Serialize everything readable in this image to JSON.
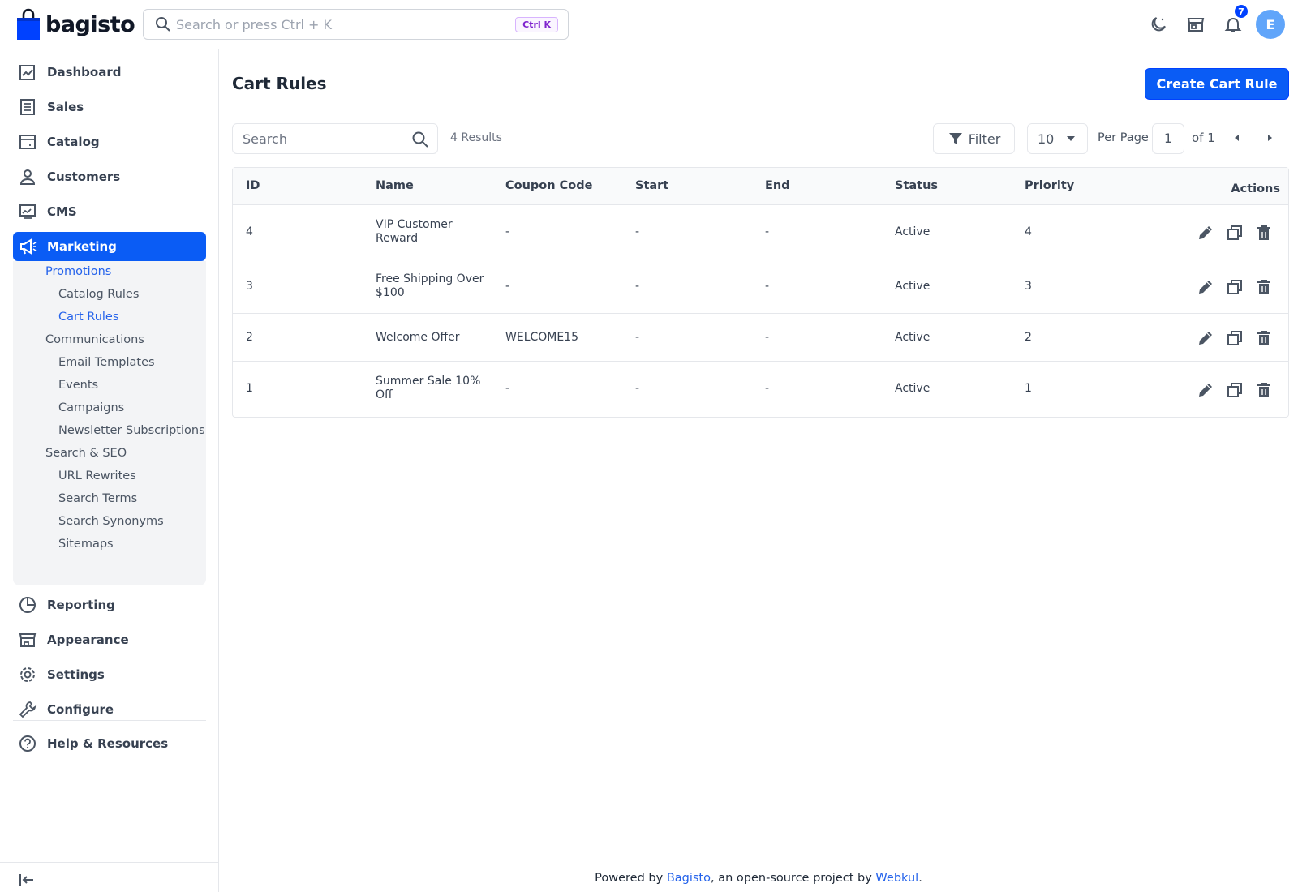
{
  "app": {
    "logo_text": "bagisto"
  },
  "header": {
    "search_placeholder": "Search or press Ctrl + K",
    "shortcut": "Ctrl K",
    "notification_count": "7",
    "avatar_initial": "E"
  },
  "sidebar": {
    "items": [
      {
        "label": "Dashboard",
        "icon": "dashboard-icon"
      },
      {
        "label": "Sales",
        "icon": "sales-icon"
      },
      {
        "label": "Catalog",
        "icon": "catalog-icon"
      },
      {
        "label": "Customers",
        "icon": "customers-icon"
      },
      {
        "label": "CMS",
        "icon": "cms-icon"
      },
      {
        "label": "Marketing",
        "icon": "megaphone-icon"
      },
      {
        "label": "Reporting",
        "icon": "reporting-icon"
      },
      {
        "label": "Appearance",
        "icon": "appearance-icon"
      },
      {
        "label": "Settings",
        "icon": "gear-icon"
      },
      {
        "label": "Configure",
        "icon": "wrench-icon"
      },
      {
        "label": "Help & Resources",
        "icon": "help-icon"
      }
    ],
    "marketing_submenu": {
      "promotions": "Promotions",
      "catalog_rules": "Catalog Rules",
      "cart_rules": "Cart Rules",
      "communications": "Communications",
      "email_templates": "Email Templates",
      "events": "Events",
      "campaigns": "Campaigns",
      "newsletter": "Newsletter Subscriptions",
      "search_seo": "Search & SEO",
      "url_rewrites": "URL Rewrites",
      "search_terms": "Search Terms",
      "search_synonyms": "Search Synonyms",
      "sitemaps": "Sitemaps"
    }
  },
  "page": {
    "title": "Cart Rules",
    "create_button": "Create Cart Rule",
    "search_placeholder": "Search",
    "results": "4 Results",
    "filter_label": "Filter",
    "per_page_value": "10",
    "per_page_label": "Per Page",
    "current_page": "1",
    "page_of": "of 1"
  },
  "table": {
    "headers": {
      "id": "ID",
      "name": "Name",
      "coupon": "Coupon Code",
      "start": "Start",
      "end": "End",
      "status": "Status",
      "priority": "Priority",
      "actions": "Actions"
    },
    "rows": [
      {
        "id": "4",
        "name": "VIP Customer Reward",
        "coupon": "-",
        "start": "-",
        "end": "-",
        "status": "Active",
        "priority": "4"
      },
      {
        "id": "3",
        "name": "Free Shipping Over $100",
        "coupon": "-",
        "start": "-",
        "end": "-",
        "status": "Active",
        "priority": "3"
      },
      {
        "id": "2",
        "name": "Welcome Offer",
        "coupon": "WELCOME15",
        "start": "-",
        "end": "-",
        "status": "Active",
        "priority": "2"
      },
      {
        "id": "1",
        "name": "Summer Sale 10% Off",
        "coupon": "-",
        "start": "-",
        "end": "-",
        "status": "Active",
        "priority": "1"
      }
    ]
  },
  "footer": {
    "prefix": "Powered by ",
    "bagisto": "Bagisto",
    "middle": ", an open-source project by ",
    "webkul": "Webkul",
    "suffix": "."
  },
  "colors": {
    "primary": "#0a5cf5",
    "link": "#2563eb",
    "border": "#e5e7eb"
  }
}
